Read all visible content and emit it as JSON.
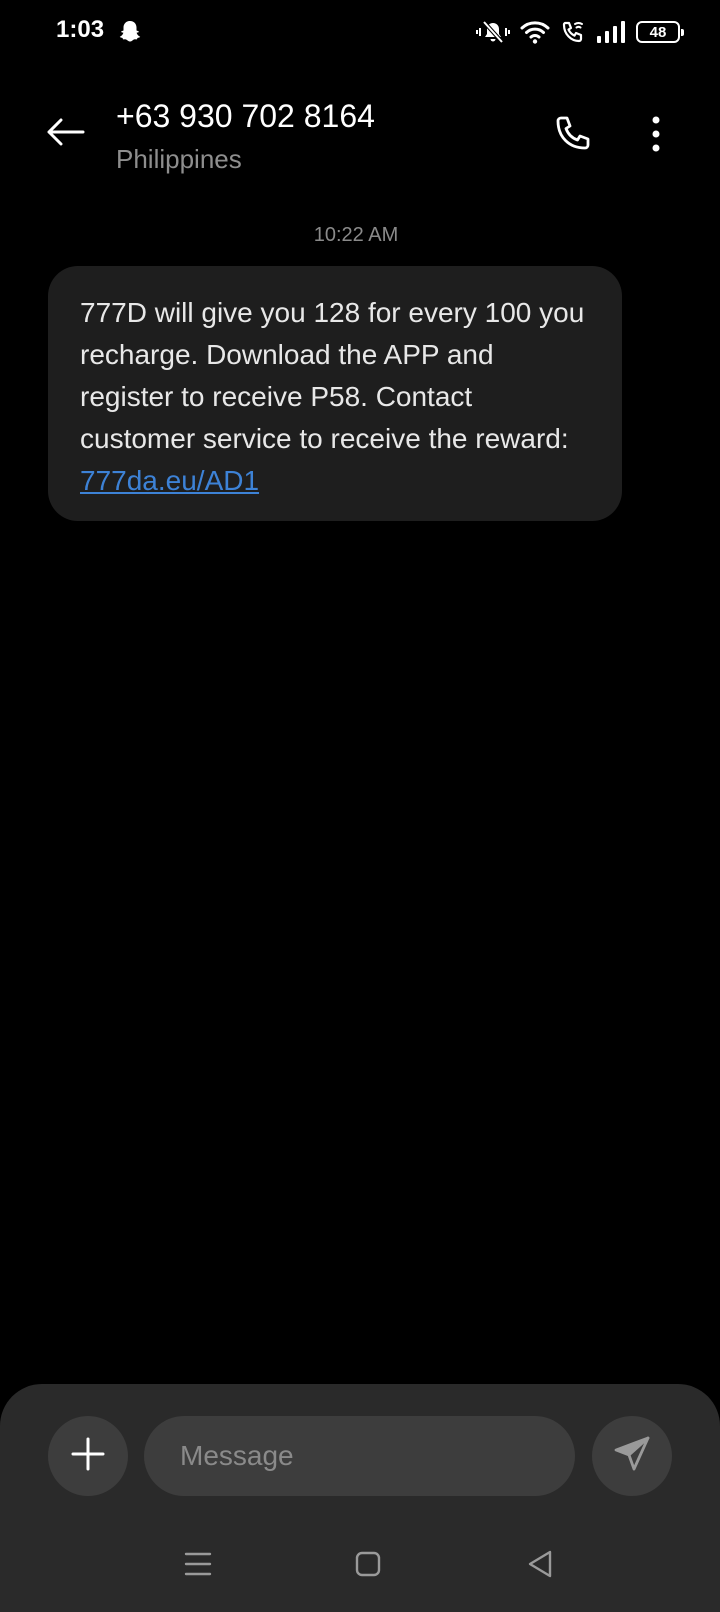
{
  "status_bar": {
    "time": "1:03",
    "battery": "48",
    "icons": [
      "snapchat-icon",
      "mute-vibrate-icon",
      "wifi-icon",
      "wifi-calling-icon",
      "signal-icon",
      "battery-icon"
    ]
  },
  "header": {
    "contact_number": "+63 930 702 8164",
    "contact_location": "Philippines",
    "icons": [
      "back-arrow-icon",
      "phone-icon",
      "more-vert-icon"
    ]
  },
  "conversation": {
    "timestamp": "10:22 AM",
    "messages": [
      {
        "text": "777D will give you 128 for every 100 you recharge. Download the APP and register to receive P58. Contact customer service to receive the reward:",
        "link": "777da.eu/AD1"
      }
    ]
  },
  "composer": {
    "placeholder": "Message",
    "icons": [
      "plus-icon",
      "send-icon"
    ]
  },
  "nav_bar": {
    "icons": [
      "menu-icon",
      "home-icon",
      "back-triangle-icon"
    ]
  },
  "colors": {
    "background": "#000000",
    "bubble": "#1e1e1e",
    "panel": "#2a2a2a",
    "control": "#3d3d3d",
    "link": "#3d82d6",
    "secondary_text": "#8e8e8e"
  }
}
